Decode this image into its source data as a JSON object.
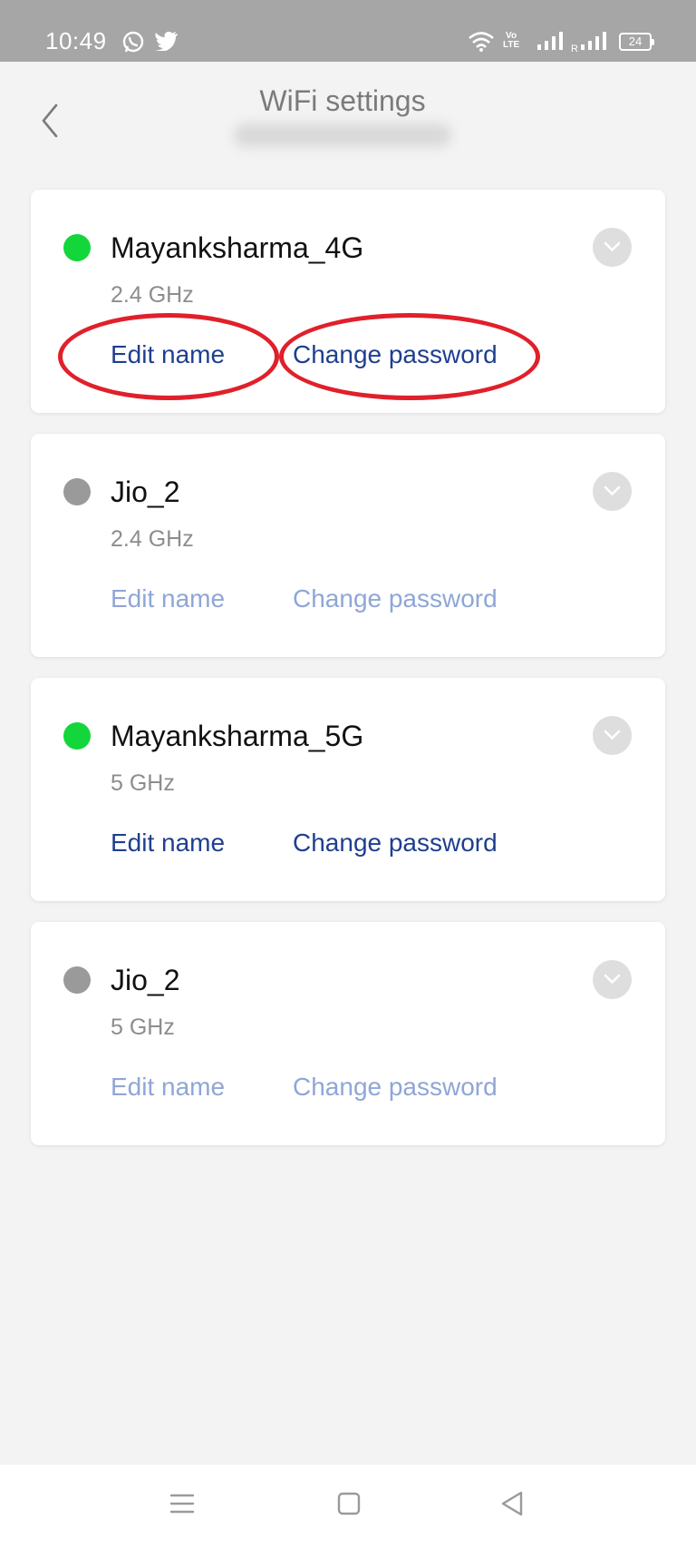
{
  "status_bar": {
    "time": "10:49",
    "battery": "24",
    "volte_top": "Vo",
    "volte_bottom": "LTE",
    "roaming": "R",
    "icons": [
      "whatsapp-icon",
      "twitter-icon",
      "wifi-icon",
      "volte-icon",
      "signal-icon",
      "signal-roaming-icon",
      "battery-icon"
    ]
  },
  "header": {
    "title": "WiFi settings"
  },
  "networks": [
    {
      "ssid": "Mayanksharma_4G",
      "band": "2.4 GHz",
      "connected": true,
      "edit_label": "Edit name",
      "password_label": "Change password"
    },
    {
      "ssid": "Jio_2",
      "band": "2.4 GHz",
      "connected": false,
      "edit_label": "Edit name",
      "password_label": "Change password"
    },
    {
      "ssid": "Mayanksharma_5G",
      "band": "5 GHz",
      "connected": true,
      "edit_label": "Edit name",
      "password_label": "Change password"
    },
    {
      "ssid": "Jio_2",
      "band": "5 GHz",
      "connected": false,
      "edit_label": "Edit name",
      "password_label": "Change password"
    }
  ],
  "colors": {
    "connected_dot": "#13d63b",
    "disconnected_dot": "#9a9a9a",
    "link_active": "#1f3f8f",
    "link_inactive": "#8fa6d7",
    "annotation": "#e0202a"
  },
  "nav_bar": {
    "icons": [
      "menu-icon",
      "home-icon",
      "back-triangle-icon"
    ]
  }
}
